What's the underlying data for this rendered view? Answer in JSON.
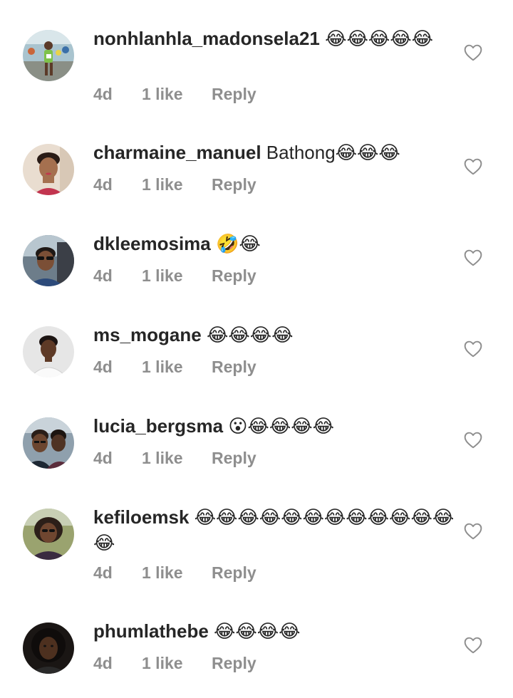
{
  "comments": [
    {
      "username": "nonhlanhla_madonsela21",
      "text": "😂😂😂😂😂",
      "time": "4d",
      "likes": "1 like",
      "reply": "Reply",
      "avatar_icon": "marathon-runner-photo"
    },
    {
      "username": "charmaine_manuel",
      "text": "Bathong😂😂😂",
      "time": "4d",
      "likes": "1 like",
      "reply": "Reply",
      "avatar_icon": "woman-portrait-photo"
    },
    {
      "username": "dkleemosima",
      "text": "🤣😂",
      "time": "4d",
      "likes": "1 like",
      "reply": "Reply",
      "avatar_icon": "woman-sunglasses-car-photo"
    },
    {
      "username": "ms_mogane",
      "text": "😂😂😂😂",
      "time": "4d",
      "likes": "1 like",
      "reply": "Reply",
      "avatar_icon": "woman-white-top-photo"
    },
    {
      "username": "lucia_bergsma",
      "text": "😮😂😂😂😂",
      "time": "4d",
      "likes": "1 like",
      "reply": "Reply",
      "avatar_icon": "two-women-selfie-photo"
    },
    {
      "username": "kefiloemsk",
      "text": "😂😂😂😂😂😂😂😂😂😂😂😂😂",
      "time": "4d",
      "likes": "1 like",
      "reply": "Reply",
      "avatar_icon": "woman-outdoor-photo"
    },
    {
      "username": "phumlathebe",
      "text": "😂😂😂😂",
      "time": "4d",
      "likes": "1 like",
      "reply": "Reply",
      "avatar_icon": "woman-curly-hair-photo"
    }
  ],
  "colors": {
    "text": "#262626",
    "meta": "#8e8e8e",
    "heart_stroke": "#8e8e8e"
  }
}
